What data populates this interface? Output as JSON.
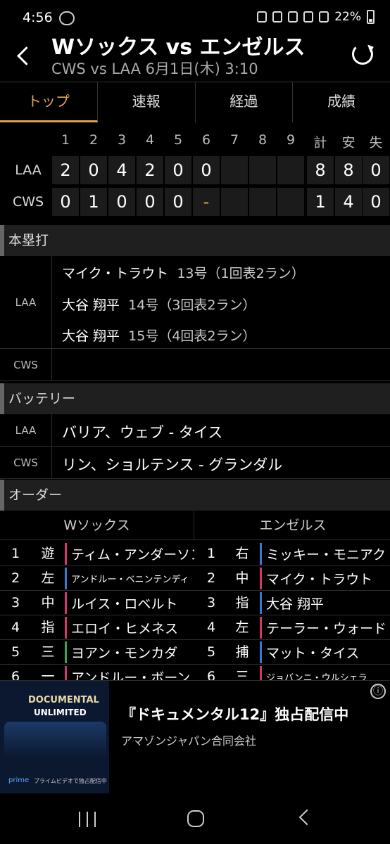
{
  "status_bar": {
    "time": "4:56",
    "battery": "22%"
  },
  "header": {
    "title": "Wソックス vs エンゼルス",
    "subtitle": "CWS vs LAA 6月1日(木) 3:10"
  },
  "tabs": [
    {
      "label": "トップ",
      "active": true
    },
    {
      "label": "速報",
      "active": false
    },
    {
      "label": "経過",
      "active": false
    },
    {
      "label": "成績",
      "active": false
    }
  ],
  "scoreboard": {
    "innings": [
      "1",
      "2",
      "3",
      "4",
      "5",
      "6",
      "7",
      "8",
      "9"
    ],
    "totals_headers": [
      "計",
      "安",
      "失"
    ],
    "teams": [
      {
        "name": "LAA",
        "innings": [
          "2",
          "0",
          "4",
          "2",
          "0",
          "0",
          "",
          "",
          ""
        ],
        "totals": [
          "8",
          "8",
          "0"
        ]
      },
      {
        "name": "CWS",
        "innings": [
          "0",
          "1",
          "0",
          "0",
          "0",
          "-",
          "",
          "",
          ""
        ],
        "totals": [
          "1",
          "4",
          "0"
        ]
      }
    ]
  },
  "home_runs": {
    "section_title": "本塁打",
    "teams": [
      {
        "team": "LAA",
        "entries": [
          {
            "player": "マイク・トラウト",
            "detail": "13号（1回表2ラン）"
          },
          {
            "player": "大谷 翔平",
            "detail": "14号（3回表2ラン）"
          },
          {
            "player": "大谷 翔平",
            "detail": "15号（4回表2ラン）"
          }
        ]
      },
      {
        "team": "CWS",
        "entries": []
      }
    ]
  },
  "battery": {
    "section_title": "バッテリー",
    "teams": [
      {
        "team": "LAA",
        "text": "バリア、ウェブ - タイス"
      },
      {
        "team": "CWS",
        "text": "リン、ショルテンス - グランダル"
      }
    ]
  },
  "order": {
    "section_title": "オーダー",
    "away_name": "Wソックス",
    "home_name": "エンゼルス",
    "rows": [
      {
        "num": "1",
        "a_pos": "遊",
        "a_name": "ティム・アンダーソン",
        "h_num": "1",
        "h_pos": "右",
        "h_name": "ミッキー・モニアク"
      },
      {
        "num": "2",
        "a_pos": "左",
        "a_name": "アンドルー・ベニンテンディ",
        "h_num": "2",
        "h_pos": "中",
        "h_name": "マイク・トラウト"
      },
      {
        "num": "3",
        "a_pos": "中",
        "a_name": "ルイス・ロベルト",
        "h_num": "3",
        "h_pos": "指",
        "h_name": "大谷 翔平"
      },
      {
        "num": "4",
        "a_pos": "指",
        "a_name": "エロイ・ヒメネス",
        "h_num": "4",
        "h_pos": "左",
        "h_name": "テーラー・ウォード"
      },
      {
        "num": "5",
        "a_pos": "三",
        "a_name": "ヨアン・モンカダ",
        "h_num": "5",
        "h_pos": "捕",
        "h_name": "マット・タイス"
      },
      {
        "num": "6",
        "a_pos": "一",
        "a_name": "アンドルー・ボーン",
        "h_num": "6",
        "h_pos": "三",
        "h_name": "ジョバンニ・ウルシェラ"
      }
    ],
    "colors": {
      "pink": "#d1386b",
      "blue": "#3a78d0",
      "green": "#3aa35a"
    }
  },
  "ad": {
    "image_line1": "DOCUMENTAL",
    "image_line2": "UNLIMITED",
    "image_prime": "prime",
    "image_pv": "プライムビデオで独占配信中",
    "title": "『ドキュメンタル12』独占配信中",
    "advertiser": "アマゾンジャパン合同会社",
    "info": "ⓘ"
  },
  "accent_color": "#e3a34a"
}
